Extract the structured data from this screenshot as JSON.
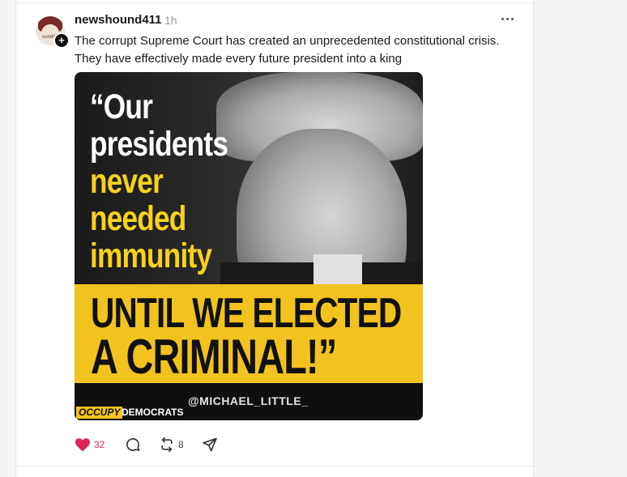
{
  "post": {
    "username": "newshound411",
    "timestamp": "1h",
    "avatar_label": "ound4",
    "text_line1": "The corrupt Supreme Court has created an unprecedented constitutional crisis.",
    "text_line2": "They have effectively made every future president into a king",
    "image": {
      "quote_line1": "“Our",
      "quote_line2": "presidents",
      "quote_line3": "never",
      "quote_line4": "needed",
      "quote_line5": "immunity",
      "band_line1": "UNTIL WE ELECTED",
      "band_line2": "A CRIMINAL!”",
      "handle": "@MICHAEL_LITTLE_",
      "logo_left": "OCCUPY",
      "logo_right": "DEMOCRATS"
    },
    "actions": {
      "like_count": "32",
      "repost_count": "8"
    }
  },
  "colors": {
    "like": "#e0245e",
    "poster_yellow": "#f2c21e",
    "text": "#1a1a1a",
    "muted": "#999999"
  },
  "icons": [
    "heart-icon",
    "comment-icon",
    "repost-icon",
    "send-icon",
    "more-icon",
    "plus-icon"
  ]
}
